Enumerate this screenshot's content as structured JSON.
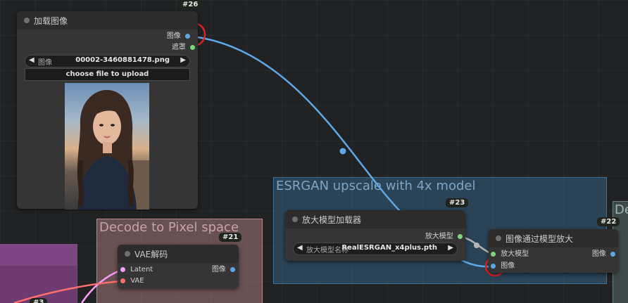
{
  "groups": {
    "esrgan": {
      "title": "ESRGAN upscale with 4x model",
      "color": "#335f80"
    },
    "decode": {
      "title": "Decode to Pixel space",
      "color": "#a67878"
    },
    "right_edge": {
      "title": "De"
    }
  },
  "nodes": {
    "load_image": {
      "id": "#26",
      "title": "加载图像",
      "outputs": [
        "图像",
        "遮罩"
      ],
      "image_combo": {
        "label": "图像",
        "value": "00002-3460881478.png"
      },
      "upload_button": "choose file to upload"
    },
    "upscale_loader": {
      "id": "#23",
      "title": "放大模型加载器",
      "output": "放大模型",
      "model_combo": {
        "label": "放大模型名称",
        "value": "RealESRGAN_x4plus.pth"
      }
    },
    "image_upscale": {
      "id": "#22",
      "title": "图像通过模型放大",
      "inputs": [
        "放大模型",
        "图像"
      ],
      "output": "图像"
    },
    "vae_decode": {
      "id": "#21",
      "title": "VAE解码",
      "inputs": [
        "Latent",
        "VAE"
      ],
      "output": "图像"
    },
    "partial_node": {
      "id": "#3"
    }
  },
  "colors": {
    "image_wire": "#5fa8e8",
    "model_wire": "#b5b5b5",
    "latent_wire": "#ff9cf9",
    "vae_wire": "#ff6e6e",
    "highlight_circle": "#e02222"
  }
}
